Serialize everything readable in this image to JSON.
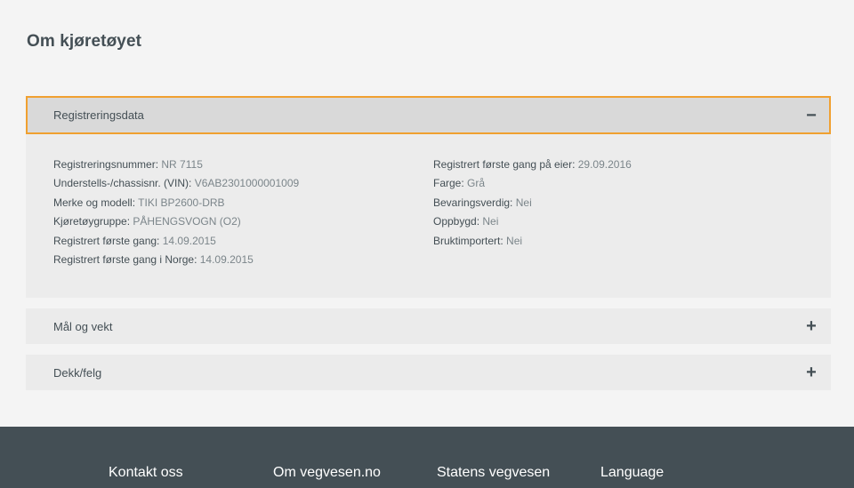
{
  "page": {
    "title": "Om kjøretøyet"
  },
  "accordions": [
    {
      "title": "Registreringsdata",
      "expanded": true,
      "toggle_icon": "minus-icon",
      "toggle_symbol": "−",
      "left_fields": [
        {
          "label": "Registreringsnummer:",
          "value": "NR 7115"
        },
        {
          "label": "Understells-/chassisnr. (VIN):",
          "value": "V6AB2301000001009"
        },
        {
          "label": "Merke og modell:",
          "value": "TIKI BP2600-DRB"
        },
        {
          "label": "Kjøretøygruppe:",
          "value": "PÅHENGSVOGN (O2)"
        },
        {
          "label": "Registrert første gang:",
          "value": "14.09.2015"
        },
        {
          "label": "Registrert første gang i Norge:",
          "value": "14.09.2015"
        }
      ],
      "right_fields": [
        {
          "label": "Registrert første gang på eier:",
          "value": "29.09.2016"
        },
        {
          "label": "Farge:",
          "value": "Grå"
        },
        {
          "label": "Bevaringsverdig:",
          "value": "Nei"
        },
        {
          "label": "Oppbygd:",
          "value": "Nei"
        },
        {
          "label": "Bruktimportert:",
          "value": "Nei"
        }
      ]
    },
    {
      "title": "Mål og vekt",
      "expanded": false,
      "toggle_icon": "plus-icon",
      "toggle_symbol": "+"
    },
    {
      "title": "Dekk/felg",
      "expanded": false,
      "toggle_icon": "plus-icon",
      "toggle_symbol": "+"
    }
  ],
  "footer": {
    "links": [
      "Kontakt oss",
      "Om vegvesen.no",
      "Statens vegvesen",
      "Language"
    ]
  },
  "colors": {
    "focus_outline": "#f0a030",
    "footer_background": "#444f55",
    "text_dark": "#444f55",
    "text_value": "#7b858a"
  }
}
